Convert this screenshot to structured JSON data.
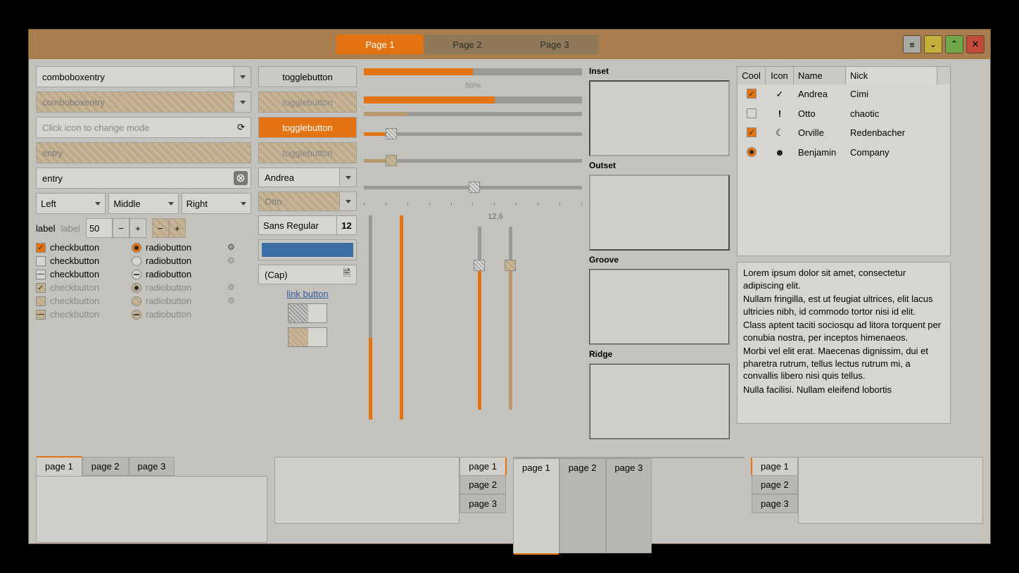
{
  "header": {
    "tabs": [
      "Page 1",
      "Page 2",
      "Page 3"
    ],
    "active_tab": 0
  },
  "col1": {
    "combo1": "comboboxentry",
    "combo2": "comboboxentry",
    "mode_placeholder": "Click icon to change mode",
    "entry_disabled": "entry",
    "entry_clear": "entry",
    "segments": [
      "Left",
      "Middle",
      "Right"
    ],
    "label1": "label",
    "label2": "label",
    "spin_value": "50",
    "check_label": "checkbutton",
    "radio_label": "radiobutton"
  },
  "col2": {
    "toggle_label": "togglebutton",
    "combo1": "Andrea",
    "combo2": "Otto",
    "font_name": "Sans Regular",
    "font_size": "12",
    "file_label": "(Cap)",
    "link_label": "link button",
    "color": "#3b6ea5"
  },
  "col3": {
    "percent_label": "50%",
    "scale_label": "12,6"
  },
  "col4": {
    "frames": [
      "Inset",
      "Outset",
      "Groove",
      "Ridge"
    ]
  },
  "col5": {
    "columns": [
      "Cool",
      "Icon",
      "Name",
      "Nick"
    ],
    "rows": [
      {
        "cool": "checked",
        "icon": "check",
        "name": "Andrea",
        "nick": "Cimi"
      },
      {
        "cool": "unchecked",
        "icon": "bang",
        "name": "Otto",
        "nick": "chaotic"
      },
      {
        "cool": "checked",
        "icon": "moon",
        "name": "Orville",
        "nick": "Redenbacher"
      },
      {
        "cool": "radio",
        "icon": "face",
        "name": "Benjamin",
        "nick": "Company"
      }
    ],
    "lorem": [
      "Lorem ipsum dolor sit amet, consectetur adipiscing elit.",
      "Nullam fringilla, est ut feugiat ultrices, elit lacus ultricies nibh, id commodo tortor nisi id elit.",
      "Class aptent taciti sociosqu ad litora torquent per conubia nostra, per inceptos himenaeos.",
      "Morbi vel elit erat. Maecenas dignissim, dui et pharetra rutrum, tellus lectus rutrum mi, a convallis libero nisi quis tellus.",
      "Nulla facilisi. Nullam eleifend lobortis"
    ]
  },
  "bottom_tabs": [
    "page 1",
    "page 2",
    "page 3"
  ]
}
